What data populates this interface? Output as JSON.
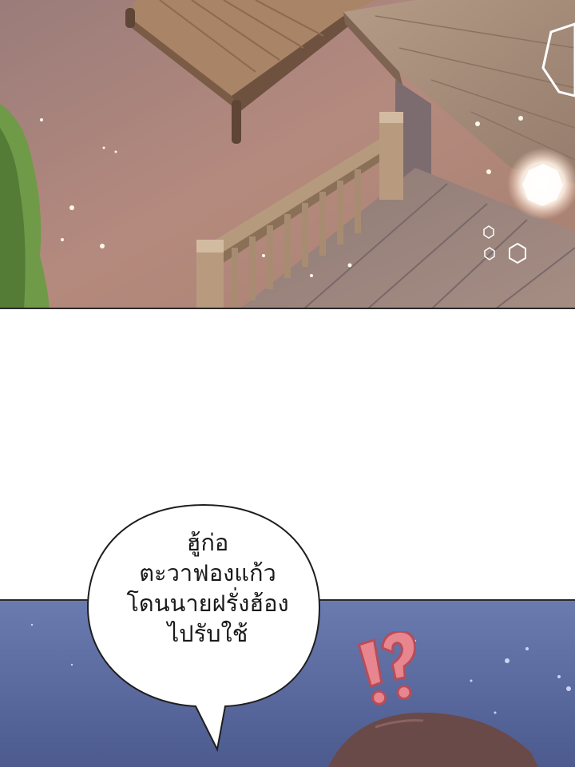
{
  "speech_bubble": {
    "lines": [
      "ฮู้ก่อ",
      "ตะวาฟองแก้ว",
      "โดนนายฝรั่งฮ้อง",
      "ไปรับใช้"
    ]
  },
  "sfx": {
    "text": "!?"
  },
  "colors": {
    "ground": "#b58a7e",
    "deck": "#9a7760",
    "roof": "#a98f7c",
    "grass": "#6f9a48",
    "night_sky": "#5a6a9c"
  }
}
